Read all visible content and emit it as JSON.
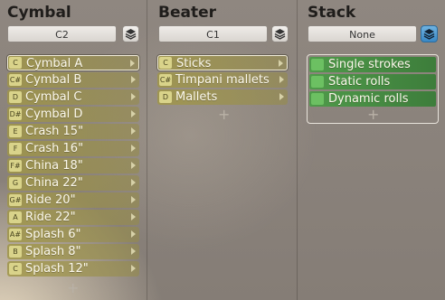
{
  "columns": {
    "cymbal": {
      "title": "Cymbal",
      "selector": {
        "value": "C2"
      },
      "items": [
        {
          "key": "C",
          "label": "Cymbal A",
          "selected": true
        },
        {
          "key": "C#",
          "label": "Cymbal B"
        },
        {
          "key": "D",
          "label": "Cymbal C"
        },
        {
          "key": "D#",
          "label": "Cymbal D"
        },
        {
          "key": "E",
          "label": "Crash 15\""
        },
        {
          "key": "F",
          "label": "Crash 16\""
        },
        {
          "key": "F#",
          "label": "China 18\""
        },
        {
          "key": "G",
          "label": "China 22\""
        },
        {
          "key": "G#",
          "label": "Ride 20\""
        },
        {
          "key": "A",
          "label": "Ride 22\""
        },
        {
          "key": "A#",
          "label": "Splash 6\""
        },
        {
          "key": "B",
          "label": "Splash 8\""
        },
        {
          "key": "C",
          "label": "Splash 12\""
        }
      ],
      "add_label": "+"
    },
    "beater": {
      "title": "Beater",
      "selector": {
        "value": "C1"
      },
      "items": [
        {
          "key": "C",
          "label": "Sticks",
          "selected": true
        },
        {
          "key": "C#",
          "label": "Timpani mallets"
        },
        {
          "key": "D",
          "label": "Mallets"
        }
      ],
      "add_label": "+"
    },
    "stack": {
      "title": "Stack",
      "selector": {
        "value": "None"
      },
      "items": [
        {
          "label": "Single strokes",
          "selected": true
        },
        {
          "label": "Static rolls"
        },
        {
          "label": "Dynamic rolls"
        }
      ],
      "add_label": "+"
    }
  },
  "colors": {
    "item_olive": "#a0964a",
    "stack_green": "#4f9a4a",
    "active_blue": "#3a88c4"
  },
  "icons": {
    "layers": "layers-icon",
    "arrow": "chevron-right-icon"
  }
}
